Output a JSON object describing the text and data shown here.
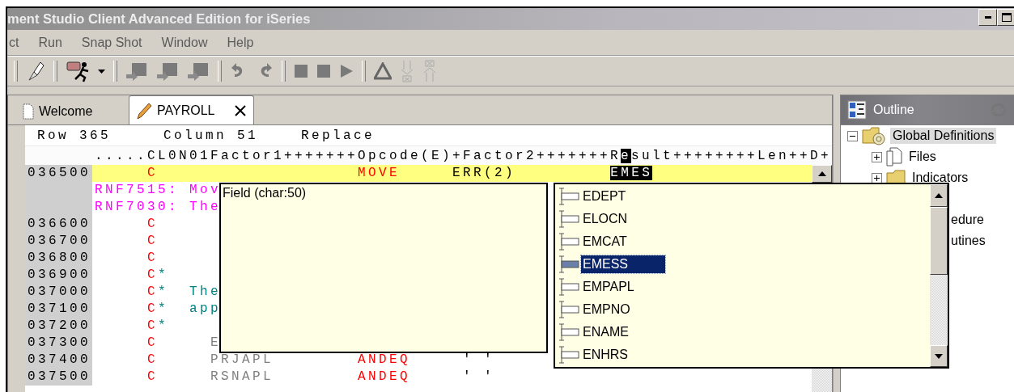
{
  "window": {
    "title": "ment Studio Client Advanced Edition for iSeries"
  },
  "menu": [
    {
      "label": "ct"
    },
    {
      "label": "Run"
    },
    {
      "label": "Snap Shot"
    },
    {
      "label": "Window"
    },
    {
      "label": "Help"
    }
  ],
  "editor_tabs": [
    {
      "label": "Welcome",
      "selected": false,
      "kind": "document"
    },
    {
      "label": "PAYROLL",
      "selected": true,
      "kind": "edit"
    }
  ],
  "status": {
    "row": "Row 365",
    "column": "Column 51",
    "mode": "Replace"
  },
  "ruler": {
    "before": ".....CL0N01Factor1+++++++Opcode(E)+Factor2+++++++R",
    "cursor": "e",
    "after": "sult++++++++Len++D+"
  },
  "lines": [
    {
      "number": "036500",
      "current": true,
      "segments": [
        {
          "text": "     C",
          "kind": "spec"
        },
        {
          "text": "                   MOVE",
          "kind": "opcode"
        },
        {
          "text": "     ERR(2)",
          "kind": "operand"
        },
        {
          "text": "         EMES",
          "kind": "selection"
        }
      ]
    },
    {
      "current": false,
      "segments": [
        {
          "text": "RNF7515: Mov",
          "kind": "message"
        }
      ]
    },
    {
      "current": false,
      "segments": [
        {
          "text": "RNF7030: The",
          "kind": "message"
        }
      ]
    },
    {
      "number": "036600",
      "current": false,
      "segments": [
        {
          "text": "     C",
          "kind": "spec"
        }
      ]
    },
    {
      "number": "036700",
      "current": false,
      "segments": [
        {
          "text": "     C",
          "kind": "spec"
        }
      ]
    },
    {
      "number": "036800",
      "current": false,
      "segments": [
        {
          "text": "     C",
          "kind": "spec"
        }
      ]
    },
    {
      "number": "036900",
      "current": false,
      "segments": [
        {
          "text": "     C",
          "kind": "spec"
        },
        {
          "text": "*",
          "kind": "comment"
        }
      ]
    },
    {
      "number": "037000",
      "current": false,
      "segments": [
        {
          "text": "     C",
          "kind": "spec"
        },
        {
          "text": "*  The",
          "kind": "comment"
        }
      ]
    },
    {
      "number": "037100",
      "current": false,
      "segments": [
        {
          "text": "     C",
          "kind": "spec"
        },
        {
          "text": "*  app",
          "kind": "comment"
        }
      ]
    },
    {
      "number": "037200",
      "current": false,
      "segments": [
        {
          "text": "     C",
          "kind": "spec"
        },
        {
          "text": "*",
          "kind": "comment"
        }
      ]
    },
    {
      "number": "037300",
      "current": false,
      "segments": [
        {
          "text": "     C",
          "kind": "spec"
        },
        {
          "text": "     E",
          "kind": "factor"
        }
      ]
    },
    {
      "number": "037400",
      "current": false,
      "segments": [
        {
          "text": "     C",
          "kind": "spec"
        },
        {
          "text": "     PRJAPL",
          "kind": "factor"
        },
        {
          "text": "        ANDEQ",
          "kind": "opcode"
        },
        {
          "text": "     ' '",
          "kind": "operand"
        }
      ]
    },
    {
      "number": "037500",
      "current": false,
      "segments": [
        {
          "text": "     C",
          "kind": "spec"
        },
        {
          "text": "     RSNAPL",
          "kind": "factor"
        },
        {
          "text": "        ANDEQ",
          "kind": "opcode"
        },
        {
          "text": "     ' '",
          "kind": "operand"
        }
      ]
    }
  ],
  "hover_info": {
    "text": "Field (char:50)"
  },
  "completion": {
    "items": [
      {
        "label": "EDEPT",
        "selected": false
      },
      {
        "label": "ELOCN",
        "selected": false
      },
      {
        "label": "EMCAT",
        "selected": false
      },
      {
        "label": "EMESS",
        "selected": true
      },
      {
        "label": "EMPAPL",
        "selected": false
      },
      {
        "label": "EMPNO",
        "selected": false
      },
      {
        "label": "ENAME",
        "selected": false
      },
      {
        "label": "ENHRS",
        "selected": false
      }
    ]
  },
  "outline": {
    "title": "Outline",
    "tree": [
      {
        "label": "Global Definitions",
        "kind": "globals",
        "expanded": true,
        "selected": true,
        "children": [
          {
            "label": "Files",
            "kind": "file",
            "expanded": false,
            "selected": false
          },
          {
            "label": "Indicators",
            "kind": "folder",
            "expanded": false,
            "selected": false
          },
          {
            "label": "edure",
            "kind": "partial",
            "selected": false
          },
          {
            "label": "utines",
            "kind": "partial",
            "selected": false
          }
        ]
      }
    ]
  }
}
